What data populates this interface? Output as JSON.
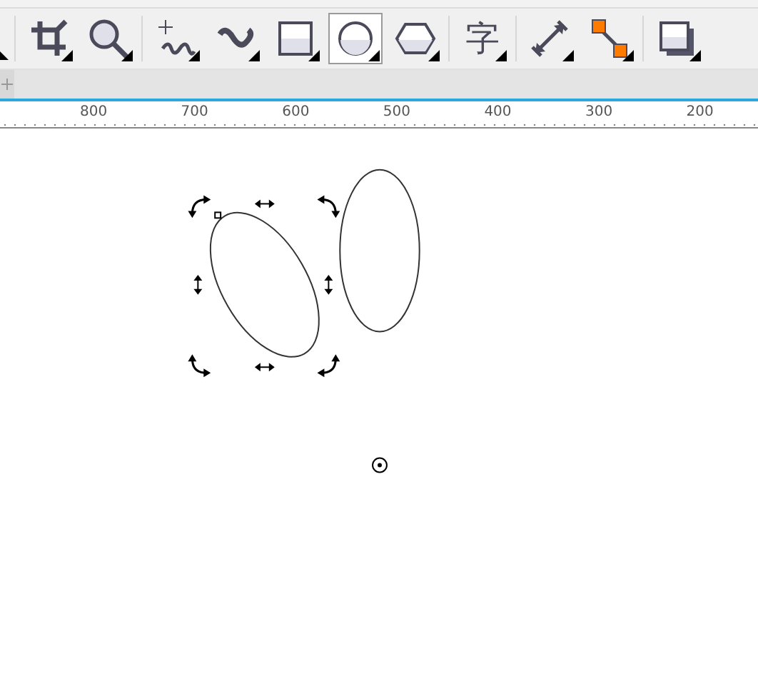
{
  "toolbar": {
    "tools": [
      {
        "kind": "crop",
        "selected": false
      },
      {
        "kind": "zoom",
        "selected": false
      },
      {
        "kind": "freehand",
        "selected": false
      },
      {
        "kind": "artistic",
        "selected": false
      },
      {
        "kind": "rectangle",
        "selected": false
      },
      {
        "kind": "ellipse",
        "selected": true
      },
      {
        "kind": "polygon",
        "selected": false
      },
      {
        "kind": "text",
        "label": "字",
        "selected": false
      },
      {
        "kind": "dimension",
        "selected": false
      },
      {
        "kind": "connector",
        "selected": false
      },
      {
        "kind": "shadow",
        "selected": false
      }
    ]
  },
  "ruler": {
    "labels": [
      "800",
      "700",
      "600",
      "500",
      "400",
      "300",
      "200"
    ]
  }
}
